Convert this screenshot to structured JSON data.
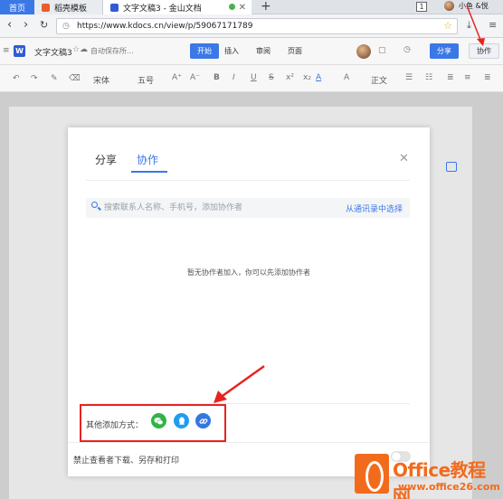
{
  "browser": {
    "tabs": [
      {
        "label": "首页"
      },
      {
        "label": "稻壳模板"
      },
      {
        "label": "文字文稿3 - 金山文档"
      }
    ],
    "tab_count": "1",
    "user_name": "小鱼 &悦",
    "url": "https://www.kdocs.cn/view/p/59067171789"
  },
  "app": {
    "doc_title": "文字文稿3",
    "save_state": "自动保存所...",
    "menu": [
      "开始",
      "插入",
      "审阅",
      "页面"
    ],
    "share_label": "分享",
    "collab_label": "协作",
    "font_name": "宋体",
    "font_size": "五号",
    "para_style": "正文"
  },
  "dialog": {
    "tabs": [
      "分享",
      "协作"
    ],
    "active_tab": "协作",
    "search_placeholder": "搜索联系人名称、手机号，添加协作者",
    "contacts_link": "从通讯录中选择",
    "empty_text": "暂无协作者加入，你可以先添加协作者",
    "other_methods_label": "其他添加方式：",
    "other_methods": [
      "wechat-icon",
      "qq-icon",
      "link-icon"
    ],
    "footer_label": "禁止查看者下载、另存和打印",
    "toggle_on": false
  },
  "watermark": {
    "brand": "Office教程网",
    "url": "www.office26.com"
  },
  "colors": {
    "accent": "#3b78e7",
    "annotation": "#e8231f",
    "watermark": "#f26b1d"
  }
}
